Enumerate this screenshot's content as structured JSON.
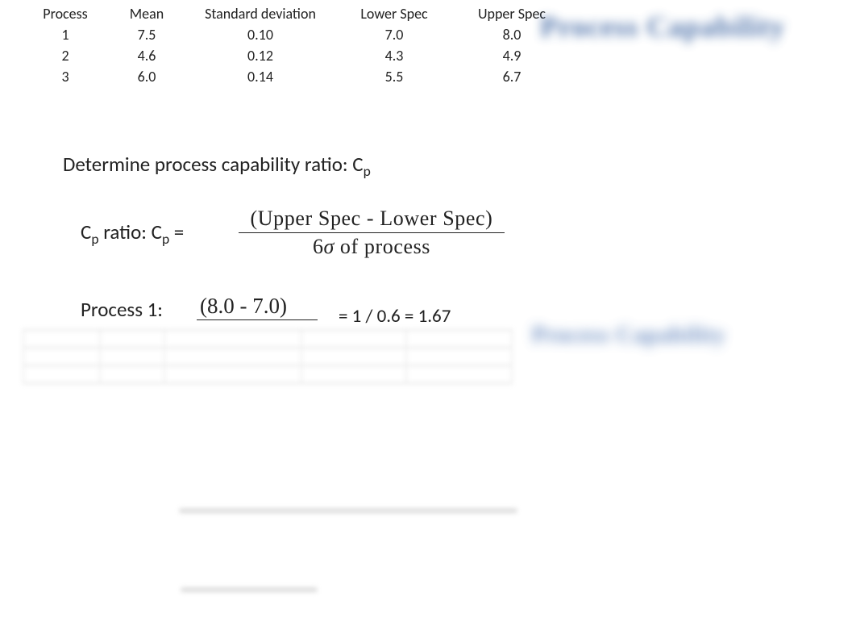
{
  "table": {
    "headers": {
      "process": "Process",
      "mean": "Mean",
      "stdev": "Standard deviation",
      "lspec": "Lower Spec",
      "uspec": "Upper Spec"
    },
    "rows": [
      {
        "process": "1",
        "mean": "7.5",
        "stdev": "0.10",
        "lspec": "7.0",
        "uspec": "8.0"
      },
      {
        "process": "2",
        "mean": "4.6",
        "stdev": "0.12",
        "lspec": "4.3",
        "uspec": "4.9"
      },
      {
        "process": "3",
        "mean": "6.0",
        "stdev": "0.14",
        "lspec": "5.5",
        "uspec": "6.7"
      }
    ]
  },
  "blur_label_top": "Process Capability",
  "blur_label_mid": "Process Capability",
  "heading_prefix": "Determine process capability ratio: C",
  "heading_sub": "p",
  "cp_label_prefix": "C",
  "cp_label_sub1": "p",
  "cp_label_mid": " ratio:  C",
  "cp_label_sub2": "p",
  "cp_label_eq": " = ",
  "fraction": {
    "numerator": "(Upper Spec - Lower Spec)",
    "den_prefix": "6",
    "den_sigma": "σ",
    "den_suffix": " of process"
  },
  "process1_label": "Process 1:",
  "process1_expr": "(8.0 - 7.0)",
  "process1_result": "= 1 / 0.6 = 1.67"
}
